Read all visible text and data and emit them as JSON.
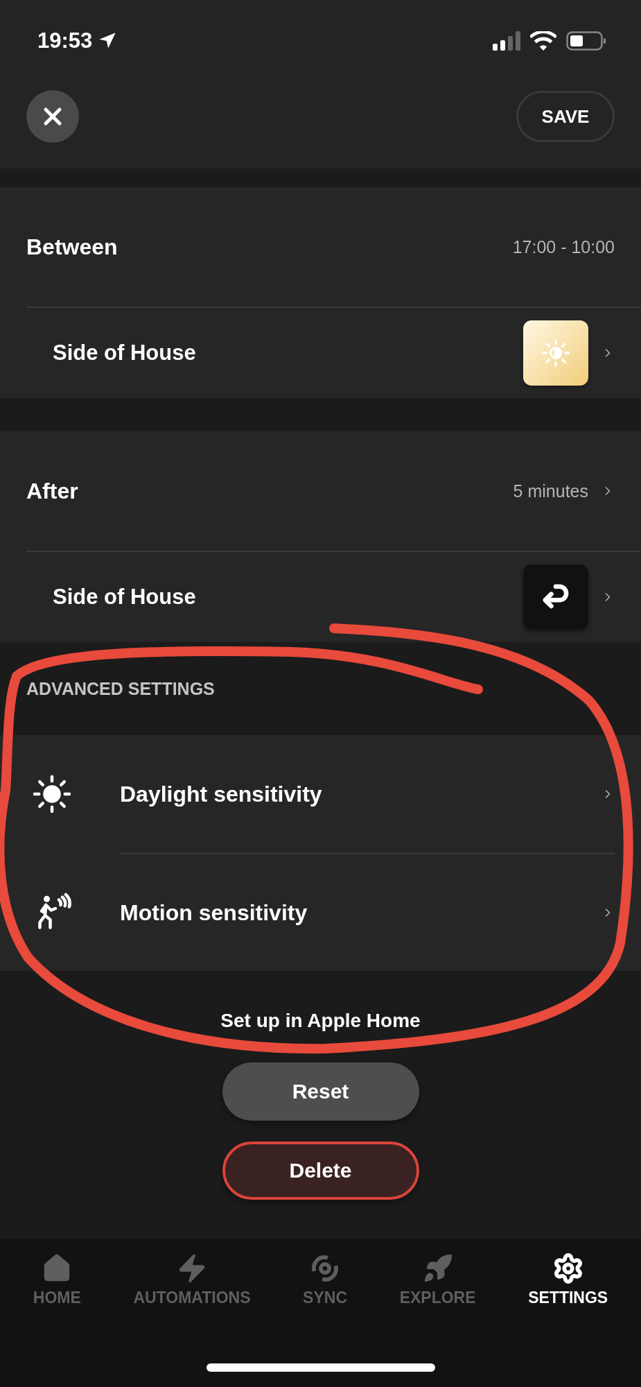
{
  "status_bar": {
    "time": "19:53"
  },
  "header": {
    "save": "SAVE"
  },
  "groups": [
    {
      "rows": [
        {
          "kind": "summary",
          "label": "Between",
          "value": "17:00 - 10:00",
          "chevron": false
        },
        {
          "kind": "scene",
          "label": "Side of House",
          "chevron": true
        }
      ]
    },
    {
      "rows": [
        {
          "kind": "summary",
          "label": "After",
          "value": "5 minutes",
          "chevron": true
        },
        {
          "kind": "action",
          "label": "Side of House",
          "chevron": true
        }
      ]
    }
  ],
  "advanced": {
    "title": "ADVANCED SETTINGS",
    "rows": [
      {
        "kind": "daylight",
        "label": "Daylight sensitivity"
      },
      {
        "kind": "motion",
        "label": "Motion sensitivity"
      }
    ]
  },
  "apple_home_link": "Set up in Apple Home",
  "buttons": [
    {
      "kind": "neutral",
      "label": "Reset"
    },
    {
      "kind": "danger",
      "label": "Delete"
    }
  ],
  "tabs": [
    {
      "kind": "home",
      "label": "HOME",
      "selected": false
    },
    {
      "kind": "automations",
      "label": "AUTOMATIONS",
      "selected": false
    },
    {
      "kind": "sync",
      "label": "SYNC",
      "selected": false
    },
    {
      "kind": "explore",
      "label": "EXPLORE",
      "selected": false
    },
    {
      "kind": "settings",
      "label": "SETTINGS",
      "selected": true
    }
  ]
}
